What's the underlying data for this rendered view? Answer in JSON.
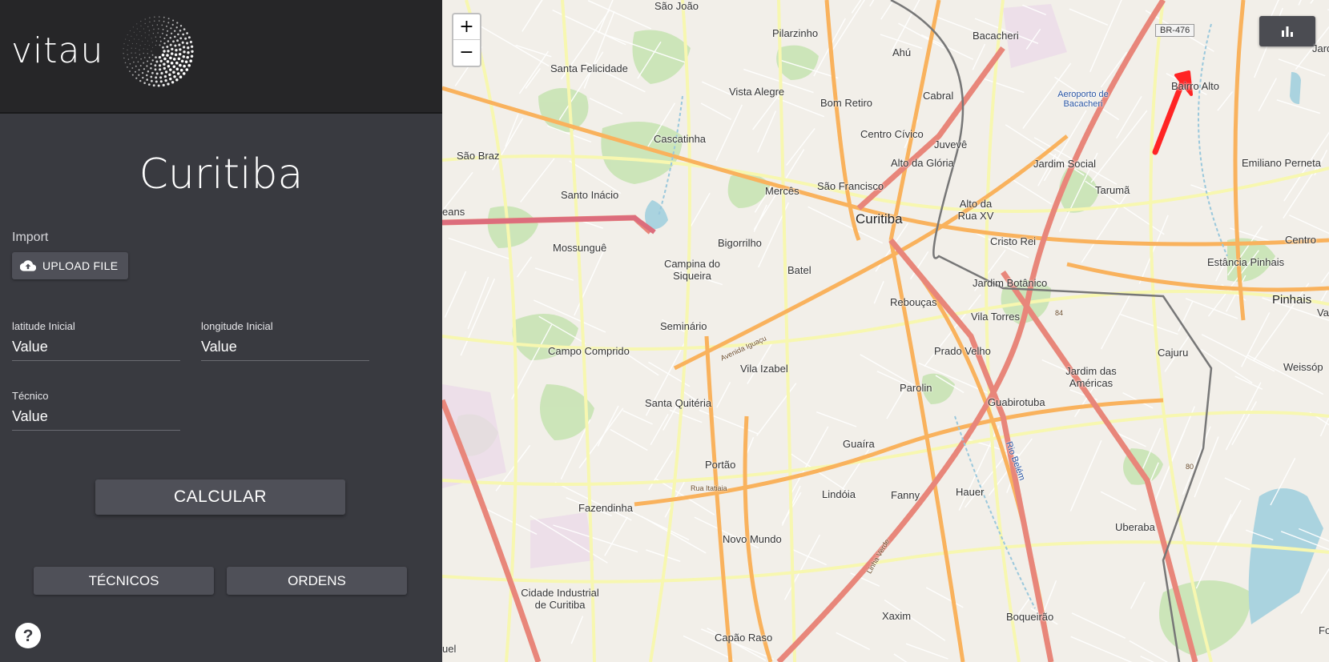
{
  "sidebar": {
    "logo_text": "vitau",
    "city_title": "Curitiba",
    "import_label": "Import",
    "upload_label": "UPLOAD FILE",
    "fields": {
      "lat_label": "latitude Inicial",
      "lat_value": "Value",
      "lon_label": "longitude Inicial",
      "lon_value": "Value",
      "tec_label": "Técnico",
      "tec_value": "Value"
    },
    "calc_label": "CALCULAR",
    "tecnicos_label": "TÉCNICOS",
    "ordens_label": "ORDENS"
  },
  "map": {
    "zoom_in": "+",
    "zoom_out": "−",
    "labels": {
      "sao_joao": "São João",
      "bacacheri": "Bacacheri",
      "pilarzinho": "Pilarzinho",
      "ahu": "Ahú",
      "santa_felicidade": "Santa Felicidade",
      "vista_alegre": "Vista Alegre",
      "cabral": "Cabral",
      "bom_retiro": "Bom Retiro",
      "bairro_alto": "Bairro Alto",
      "aeroporto": "Aeroporto de Bacacheri",
      "cascatinha": "Cascatinha",
      "centro_civico": "Centro Cívico",
      "juveve": "Juvevê",
      "sao_braz": "São Braz",
      "alto_gloria": "Alto da Glória",
      "jardim_social": "Jardim Social",
      "emiliano": "Emiliano Perneta",
      "santo_inacio": "Santo Inácio",
      "merces": "Mercês",
      "sao_francisco": "São Francisco",
      "taruma": "Tarumã",
      "alto_rua": "Alto da Rua XV",
      "curitiba": "Curitiba",
      "mossungue": "Mossunguê",
      "bigorrilho": "Bigorrilho",
      "cristo_rei": "Cristo Rei",
      "centro": "Centro",
      "campina": "Campina do Siqueira",
      "batel": "Batel",
      "jardim_botanico": "Jardim Botânico",
      "estancia": "Estância Pinhais",
      "pinhais": "Pinhais",
      "reboucas": "Rebouças",
      "seminario": "Seminário",
      "vila_torres": "Vila Torres",
      "campo_comprido": "Campo Comprido",
      "prado_velho": "Prado Velho",
      "cajuru": "Cajuru",
      "vila_izabel": "Vila Izabel",
      "jardim_americas": "Jardim das Américas",
      "weissop": "Weissóp",
      "parolin": "Parolin",
      "santa_quiteria": "Santa Quitéria",
      "guabirotuba": "Guabirotuba",
      "guaira": "Guaíra",
      "portao": "Portão",
      "lindoia": "Lindóia",
      "fanny": "Fanny",
      "hauer": "Hauer",
      "fazendinha": "Fazendinha",
      "uberaba": "Uberaba",
      "novo_mundo": "Novo Mundo",
      "cidade_industrial": "Cidade Industrial de Curitiba",
      "xaxim": "Xaxim",
      "boqueirao": "Boqueirão",
      "capao_raso": "Capão Raso",
      "br476": "BR-476",
      "route84": "84",
      "route80": "80",
      "eans": "eans",
      "uel": "uel",
      "jard": "Jard",
      "va": "Va",
      "fo": "Fo",
      "rua_itatiaia": "Rua Itatiaia",
      "avenida_iguacu": "Avenida Iguaçu",
      "rio_belem": "Rio Belém",
      "linha_verde": "Linha Verde"
    }
  },
  "colors": {
    "sidebar_bg": "#393a40",
    "header_bg": "#262628",
    "button_bg": "#4f5058",
    "map_bg": "#f2efe9",
    "arrow": "#ff2424"
  }
}
